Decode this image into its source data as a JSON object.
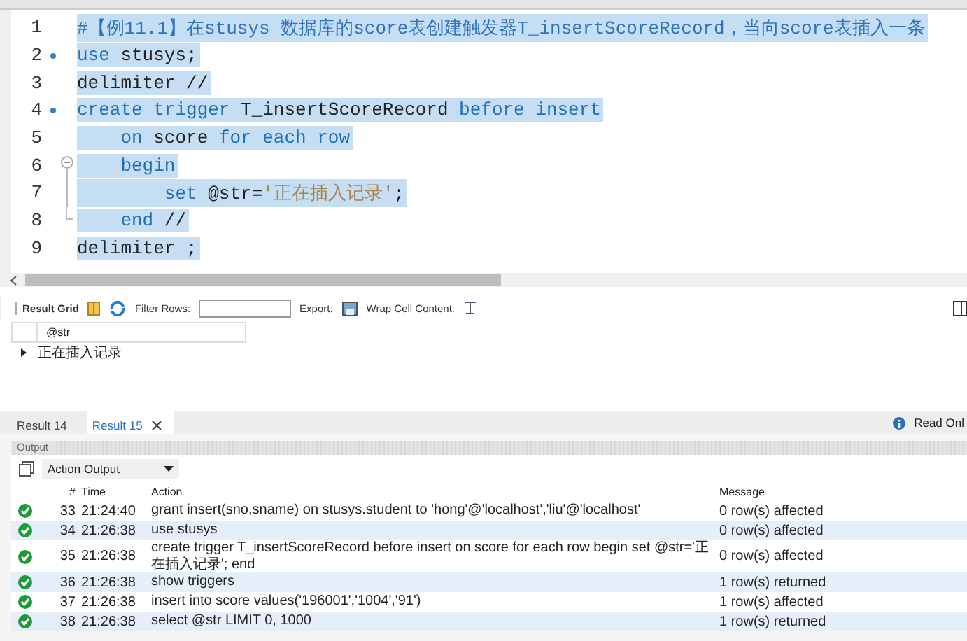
{
  "editor": {
    "lines": [
      {
        "number": "1",
        "kind": "plain",
        "selected": true,
        "tokens": [
          {
            "kind": "comment",
            "text": "#【例11.1】在stusys 数据库的score表创建触发器T_insertScoreRecord，当向score表插入一条"
          }
        ]
      },
      {
        "number": "2",
        "kind": "statement",
        "selected": true,
        "tokens": [
          {
            "kind": "keyword",
            "text": "use"
          },
          {
            "kind": "plain",
            "text": " stusys;"
          }
        ]
      },
      {
        "number": "3",
        "kind": "plain",
        "selected": true,
        "tokens": [
          {
            "kind": "plain",
            "text": "delimiter //"
          }
        ]
      },
      {
        "number": "4",
        "kind": "statement",
        "selected": true,
        "tokens": [
          {
            "kind": "keyword",
            "text": "create trigger"
          },
          {
            "kind": "plain",
            "text": " T_insertScoreRecord "
          },
          {
            "kind": "keyword",
            "text": "before insert"
          }
        ]
      },
      {
        "number": "5",
        "kind": "plain",
        "selected": true,
        "tokens": [
          {
            "kind": "keyword",
            "text": "    on"
          },
          {
            "kind": "plain",
            "text": " score "
          },
          {
            "kind": "keyword",
            "text": "for each row"
          }
        ]
      },
      {
        "number": "6",
        "kind": "foldstart",
        "selected": true,
        "tokens": [
          {
            "kind": "keyword",
            "text": "    begin"
          }
        ]
      },
      {
        "number": "7",
        "kind": "foldbody",
        "selected": true,
        "tokens": [
          {
            "kind": "keyword",
            "text": "        set"
          },
          {
            "kind": "plain",
            "text": " @str="
          },
          {
            "kind": "string",
            "text": "'正在插入记录'"
          },
          {
            "kind": "plain",
            "text": ";"
          }
        ]
      },
      {
        "number": "8",
        "kind": "foldend",
        "selected": true,
        "tokens": [
          {
            "kind": "keyword",
            "text": "    end"
          },
          {
            "kind": "plain",
            "text": " //"
          }
        ]
      },
      {
        "number": "9",
        "kind": "plain",
        "selected": true,
        "tokens": [
          {
            "kind": "plain",
            "text": "delimiter ;"
          }
        ]
      }
    ]
  },
  "result_toolbar": {
    "result_grid": "Result Grid",
    "filter_label": "Filter Rows:",
    "export_label": "Export:",
    "wrap_label": "Wrap Cell Content:"
  },
  "result_grid": {
    "columns": [
      "@str"
    ],
    "rows": [
      [
        "正在插入记录"
      ]
    ]
  },
  "result_tabs": [
    {
      "label": "Result 14",
      "selected": false
    },
    {
      "label": "Result 15",
      "selected": true
    }
  ],
  "read_only": "Read Onl",
  "output": {
    "title": "Output",
    "dropdown": "Action Output",
    "columns": [
      "#",
      "Time",
      "Action",
      "Message"
    ],
    "rows": [
      {
        "success": true,
        "number": "33",
        "time": "21:24:40",
        "action": "grant insert(sno,sname) on stusys.student     to 'hong'@'localhost','liu'@'localhost'",
        "message": "0 row(s) affected"
      },
      {
        "success": true,
        "number": "34",
        "time": "21:26:38",
        "action": "use stusys",
        "message": "0 row(s) affected"
      },
      {
        "success": true,
        "number": "35",
        "time": "21:26:38",
        "action": "create trigger T_insertScoreRecord before insert on score for each row     begin set @str='正在插入记录'; end",
        "message": "0 row(s) affected"
      },
      {
        "success": true,
        "number": "36",
        "time": "21:26:38",
        "action": "show triggers",
        "message": "1 row(s) returned"
      },
      {
        "success": true,
        "number": "37",
        "time": "21:26:38",
        "action": "insert into score values('196001','1004','91')",
        "message": "1 row(s) affected"
      },
      {
        "success": true,
        "number": "38",
        "time": "21:26:38",
        "action": "select @str LIMIT 0, 1000",
        "message": "1 row(s) returned"
      }
    ]
  }
}
